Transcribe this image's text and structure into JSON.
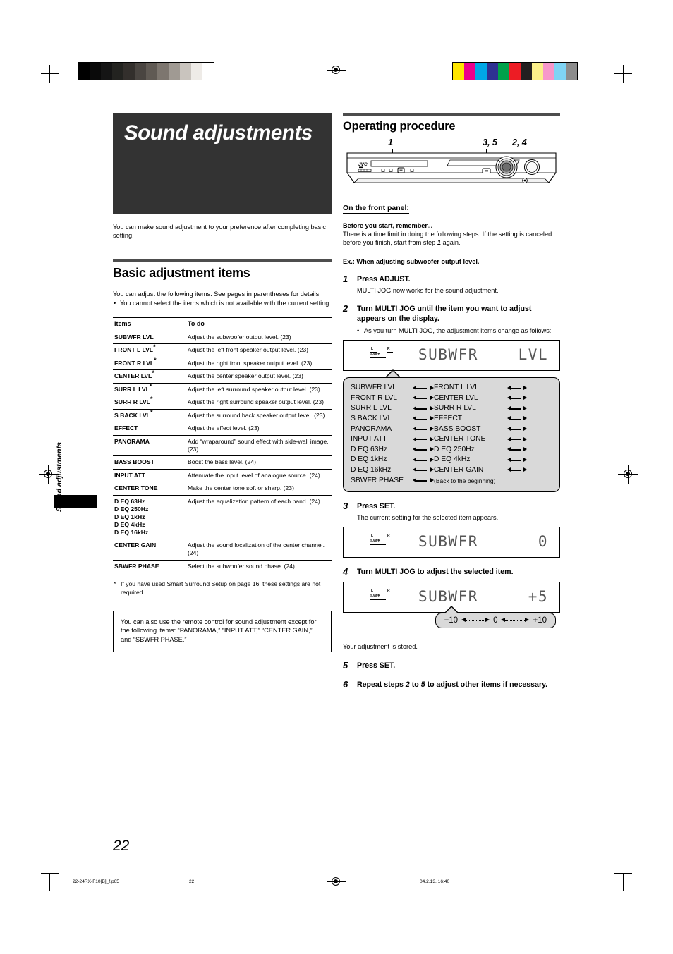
{
  "chapter": {
    "title": "Sound adjustments",
    "side_tab_label": "Sound adjustments",
    "intro": "You can make sound adjustment to your preference after completing basic setting."
  },
  "basic_section": {
    "heading": "Basic adjustment items",
    "para": "You can adjust the following items. See pages in parentheses for details.",
    "bullet": "You cannot select the items which is not available with the current setting.",
    "table": {
      "headers": [
        "Items",
        "To do"
      ],
      "rows": [
        {
          "item": "SUBWFR LVL",
          "star": "",
          "todo": "Adjust the subwoofer output level. (23)"
        },
        {
          "item": "FRONT L LVL",
          "star": "*",
          "todo": "Adjust the left front speaker output level. (23)"
        },
        {
          "item": "FRONT R LVL",
          "star": "*",
          "todo": "Adjust the right front speaker output level. (23)"
        },
        {
          "item": "CENTER LVL",
          "star": "*",
          "todo": "Adjust the center speaker output level. (23)"
        },
        {
          "item": "SURR L LVL",
          "star": "*",
          "todo": "Adjust the left surround speaker output level. (23)"
        },
        {
          "item": "SURR R LVL",
          "star": "*",
          "todo": "Adjust the right surround speaker output level. (23)"
        },
        {
          "item": "S BACK LVL",
          "star": "*",
          "todo": "Adjust the surround back speaker output level. (23)"
        },
        {
          "item": "EFFECT",
          "star": "",
          "todo": "Adjust the effect level. (23)"
        },
        {
          "item": "PANORAMA",
          "star": "",
          "todo": "Add “wraparound” sound effect with side-wall image. (23)"
        },
        {
          "item": "BASS BOOST",
          "star": "",
          "todo": "Boost the bass level. (24)"
        },
        {
          "item": "INPUT ATT",
          "star": "",
          "todo": "Attenuate the input level of analogue source. (24)"
        },
        {
          "item": "CENTER TONE",
          "star": "",
          "todo": "Make the center tone soft or sharp. (23)"
        },
        {
          "item": "D EQ 63Hz",
          "star": "",
          "item_lines": [
            "D EQ 63Hz",
            "D EQ 250Hz",
            "D EQ 1kHz",
            "D EQ 4kHz",
            "D EQ 16kHz"
          ],
          "todo": "Adjust the equalization pattern of each band. (24)"
        },
        {
          "item": "CENTER GAIN",
          "star": "",
          "todo": "Adjust the sound localization of the center channel. (24)"
        },
        {
          "item": "SBWFR PHASE",
          "star": "",
          "todo": "Select the subwoofer sound phase. (24)"
        }
      ]
    },
    "footnote": "If you have used Smart Surround Setup on page 16, these settings are not required.",
    "note_box": "You can also use the remote control for sound adjustment except for the following items: “PANORAMA,” “INPUT ATT,” “CENTER GAIN,” and “SBWFR PHASE.”"
  },
  "procedure": {
    "heading": "Operating procedure",
    "device_callouts": {
      "left": "1",
      "middle": "3, 5",
      "right": "2, 4"
    },
    "device_brand": "JVC",
    "front_panel_heading": "On the front panel:",
    "before_heading": "Before you start, remember...",
    "before_text_a": "There is a time limit in doing the following steps. If the setting is canceled before you finish, start from step",
    "before_step": "1",
    "before_text_b": "again.",
    "example_line": "Ex.: When adjusting subwoofer output level.",
    "steps": [
      {
        "num": "1",
        "title": "Press ADJUST.",
        "sub": "MULTI JOG now works for the sound adjustment."
      },
      {
        "num": "2",
        "title": "Turn MULTI JOG until the item you want to adjust appears on the display.",
        "bullet": "As you turn MULTI JOG, the adjustment items change as follows:"
      },
      {
        "num": "3",
        "title": "Press SET.",
        "sub": "The current setting for the selected item appears."
      },
      {
        "num": "4",
        "title": "Turn MULTI JOG to adjust the selected item.",
        "after": "Your adjustment is stored."
      },
      {
        "num": "5",
        "title": "Press SET."
      },
      {
        "num": "6",
        "title_a": "Repeat steps",
        "title_from": "2",
        "title_mid": "to",
        "title_to": "5",
        "title_b": "to adjust other items if necessary."
      }
    ],
    "lcd1": {
      "left": "SUBWFR",
      "right": "LVL",
      "ind_l": "L",
      "ind_r": "R",
      "ind_sw": "S.WFR"
    },
    "lcd2": {
      "left": "SUBWFR",
      "right": "0",
      "ind_l": "L",
      "ind_r": "R",
      "ind_sw": "S.WFR"
    },
    "lcd3": {
      "left": "SUBWFR",
      "right": "+5",
      "ind_l": "L",
      "ind_r": "R",
      "ind_sw": "S.WFR"
    },
    "range": {
      "min": "−10",
      "mid": "0",
      "max": "+10"
    },
    "flow_rows": [
      {
        "a": "SUBWFR LVL",
        "b": "FRONT L LVL"
      },
      {
        "a": "FRONT R LVL",
        "b": "CENTER LVL"
      },
      {
        "a": "SURR L LVL",
        "b": "SURR R LVL"
      },
      {
        "a": "S BACK LVL",
        "b": "EFFECT"
      },
      {
        "a": "PANORAMA",
        "b": "BASS BOOST"
      },
      {
        "a": "INPUT ATT",
        "b": "CENTER TONE"
      },
      {
        "a": "D EQ 63Hz",
        "b": "D EQ 250Hz"
      },
      {
        "a": "D EQ 1kHz",
        "b": "D EQ 4kHz"
      },
      {
        "a": "D EQ 16kHz",
        "b": "CENTER GAIN"
      },
      {
        "a": "SBWFR PHASE",
        "b": "(Back to the beginning)",
        "last": true
      }
    ]
  },
  "footer": {
    "page_number": "22",
    "filename": "22-24RX-F10[B]_f.p65",
    "center_page": "22",
    "timestamp": "04.2.13, 16:40"
  },
  "print_marks": {
    "gray_wedge": [
      "#000000",
      "#0a0a0a",
      "#151515",
      "#232320",
      "#332f2c",
      "#4a4541",
      "#605a54",
      "#7d766f",
      "#a09a93",
      "#c9c4be",
      "#eeebe7",
      "#ffffff"
    ],
    "color_bars": [
      "#ffe600",
      "#ec008c",
      "#00a7e7",
      "#2e3192",
      "#00a14b",
      "#ed1c24",
      "#231f20",
      "#fbef8a",
      "#f797ca",
      "#7fd4f4",
      "#8c8c8c"
    ]
  }
}
